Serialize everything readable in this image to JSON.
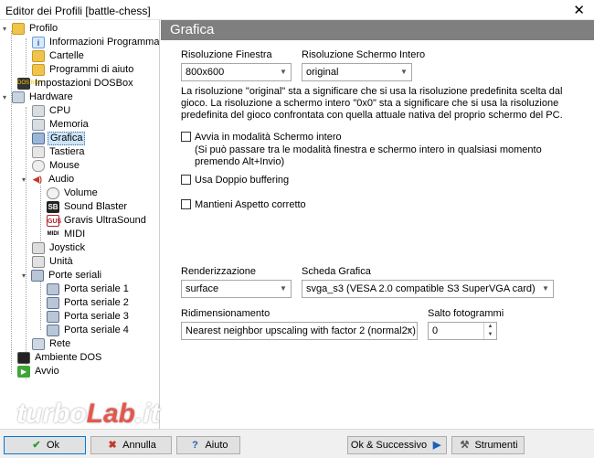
{
  "window": {
    "title": "Editor dei Profili [battle-chess]",
    "close_glyph": "✕"
  },
  "tree": {
    "profilo": "Profilo",
    "informazioni": "Informazioni Programma",
    "cartelle": "Cartelle",
    "programmi_aiuto": "Programmi di aiuto",
    "impostazioni_dosbox": "Impostazioni DOSBox",
    "hardware": "Hardware",
    "cpu": "CPU",
    "memoria": "Memoria",
    "grafica": "Grafica",
    "tastiera": "Tastiera",
    "mouse": "Mouse",
    "audio": "Audio",
    "volume": "Volume",
    "sound_blaster": "Sound Blaster",
    "gravis": "Gravis UltraSound",
    "midi": "MIDI",
    "joystick": "Joystick",
    "unita": "Unità",
    "porte_seriali": "Porte seriali",
    "porta1": "Porta seriale 1",
    "porta2": "Porta seriale 2",
    "porta3": "Porta seriale 3",
    "porta4": "Porta seriale 4",
    "rete": "Rete",
    "ambiente_dos": "Ambiente DOS",
    "avvio": "Avvio"
  },
  "icons": {
    "sb": "SB",
    "gus": "GUS",
    "midi": "MIDI",
    "dosbox": "DOS BOX",
    "info": "i",
    "run": "▶",
    "spk": "◀)"
  },
  "grafica": {
    "header": "Grafica",
    "risoluzione_finestra_label": "Risoluzione Finestra",
    "risoluzione_finestra_value": "800x600",
    "risoluzione_schermo_label": "Risoluzione Schermo Intero",
    "risoluzione_schermo_value": "original",
    "description": "La risoluzione \"original\" sta a significare che si usa la risoluzione predefinita scelta dal gioco. La risoluzione a schermo intero \"0x0\" sta a significare che si usa la risoluzione predefinita del gioco confrontata con quella attuale nativa del proprio schermo del PC.",
    "avvia_schermo_intero": "Avvia in modalità Schermo intero",
    "avvia_note": "(Si può passare tra le modalità finestra e schermo intero in qualsiasi momento premendo Alt+Invio)",
    "doppio_buffering": "Usa Doppio buffering",
    "aspetto_corretto": "Mantieni Aspetto corretto",
    "renderizzazione_label": "Renderizzazione",
    "renderizzazione_value": "surface",
    "scheda_grafica_label": "Scheda Grafica",
    "scheda_grafica_value": "svga_s3 (VESA 2.0 compatible S3 SuperVGA card)",
    "ridimensionamento_label": "Ridimensionamento",
    "ridimensionamento_value": "Nearest neighbor upscaling with factor 2 (normal2x)",
    "salto_label": "Salto fotogrammi",
    "salto_value": "0"
  },
  "buttons": {
    "ok": "Ok",
    "annulla": "Annulla",
    "aiuto": "Aiuto",
    "ok_successivo": "Ok & Successivo",
    "strumenti": "Strumenti"
  },
  "watermark": {
    "part1": "turbo",
    "part2": "Lab",
    "part3": ".it"
  }
}
